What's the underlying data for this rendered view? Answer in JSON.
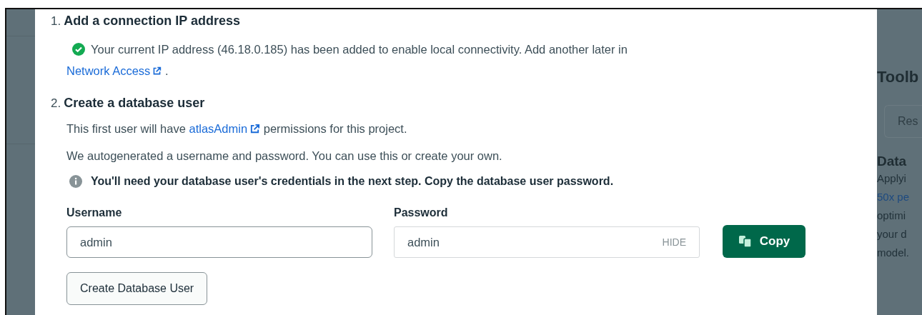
{
  "background": {
    "heading": "Toolb",
    "tab": "Res",
    "section_title": "Data",
    "lines": [
      {
        "text": "Applyi",
        "kind": "text"
      },
      {
        "text": "50x pe",
        "kind": "link"
      },
      {
        "text": "optimi",
        "kind": "text"
      },
      {
        "text": "your d",
        "kind": "text"
      },
      {
        "text": "model.",
        "kind": "text"
      }
    ]
  },
  "modal": {
    "steps": [
      {
        "number": "1.",
        "title": "Add a connection IP address"
      },
      {
        "number": "2.",
        "title": "Create a database user"
      }
    ],
    "ip_notice": {
      "text": "Your current IP address (46.18.0.185) has been added to enable local connectivity. Add another later in",
      "link": "Network Access",
      "end": "."
    },
    "permission": {
      "before": "This first user will have",
      "link": "atlasAdmin",
      "after": "permissions for this project."
    },
    "note": "We autogenerated a username and password. You can use this or create your own.",
    "info": "You'll need your database user's credentials in the next step. Copy the database user password.",
    "fields": [
      {
        "label": "Username",
        "value": "admin",
        "kind": "text"
      },
      {
        "label": "Password",
        "value": "admin",
        "kind": "password",
        "toggle": "HIDE"
      }
    ],
    "copy_button": "Copy",
    "submit_button": "Create Database User"
  }
}
